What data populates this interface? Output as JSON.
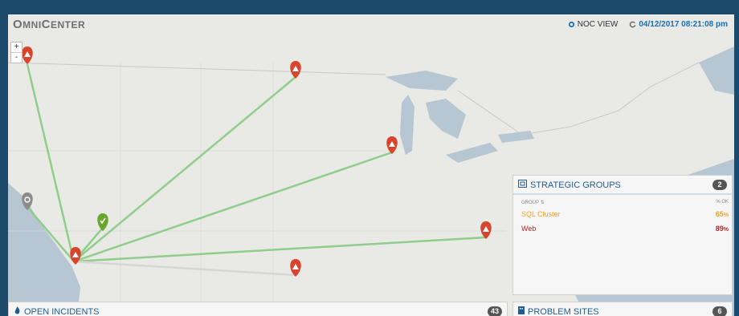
{
  "header": {
    "brand_first": "O",
    "brand_rest": "MNI",
    "brand_second_first": "C",
    "brand_second_rest": "ENTER",
    "noc_label": "NOC VIEW",
    "timestamp": "04/12/2017 08:21:08 pm"
  },
  "map": {
    "zoom_in": "+",
    "zoom_out": "-",
    "line_color": "#8fce8a",
    "alert_color": "#d9442c",
    "ok_color": "#6aa62a",
    "unknown_color": "#8c8c8c",
    "sites": [
      {
        "status": "alert",
        "icon": "warning-icon"
      },
      {
        "status": "alert",
        "icon": "warning-icon"
      },
      {
        "status": "alert",
        "icon": "warning-icon"
      },
      {
        "status": "alert",
        "icon": "warning-icon"
      },
      {
        "status": "alert",
        "icon": "warning-icon"
      },
      {
        "status": "alert",
        "icon": "warning-icon"
      },
      {
        "status": "ok",
        "icon": "check-icon"
      },
      {
        "status": "unknown",
        "icon": "settings-icon"
      }
    ]
  },
  "strategic_groups": {
    "title": "STRATEGIC GROUPS",
    "count": "2",
    "col_group": "GROUP",
    "col_pct": "% OK",
    "rows": [
      {
        "name": "SQL Cluster",
        "pct": "65",
        "color": "#f0a030"
      },
      {
        "name": "Web",
        "pct": "89",
        "color": "#b02a2a"
      }
    ]
  },
  "open_incidents": {
    "title": "OPEN INCIDENTS",
    "count": "43"
  },
  "problem_sites": {
    "title": "PROBLEM SITES",
    "count": "6"
  }
}
